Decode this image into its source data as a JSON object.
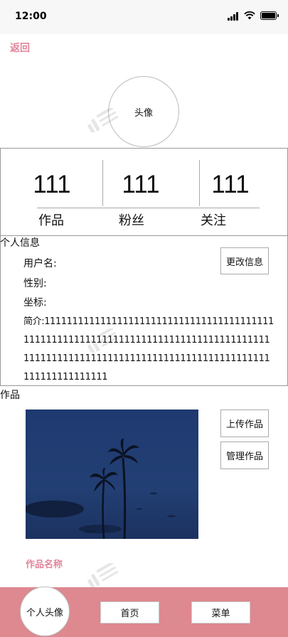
{
  "status_bar": {
    "time": "12:00"
  },
  "nav": {
    "back_label": "返回"
  },
  "profile": {
    "avatar_label": "头像"
  },
  "stats": [
    {
      "value": "111",
      "label": "作品"
    },
    {
      "value": "111",
      "label": "粉丝"
    },
    {
      "value": "111",
      "label": "关注"
    }
  ],
  "info": {
    "title": "个人信息",
    "username_label": "用户名:",
    "gender_label": "性别:",
    "location_label": "坐标:",
    "bio_label": "简介:",
    "bio_text": "111111111111111111111111111111111111111111111111111111111111111111111111111111111111111111111111111111111111111111111111111111111111111111111111",
    "edit_button": "更改信息"
  },
  "works": {
    "title": "作品",
    "upload_button": "上传作品",
    "manage_button": "管理作品",
    "item_name": "作品名称"
  },
  "bottom_nav": {
    "avatar_label": "个人头像",
    "home_label": "首页",
    "menu_label": "菜单"
  },
  "colors": {
    "accent": "#e0869a",
    "bottom_bar": "#de8890",
    "image_sky": "#1f3a70"
  }
}
